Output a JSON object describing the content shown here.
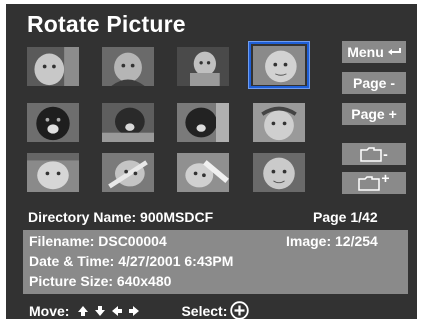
{
  "title": "Rotate Picture",
  "thumbnails": [
    {
      "row": 0,
      "col": 0,
      "selected": false
    },
    {
      "row": 0,
      "col": 1,
      "selected": false
    },
    {
      "row": 0,
      "col": 2,
      "selected": false
    },
    {
      "row": 0,
      "col": 3,
      "selected": true
    },
    {
      "row": 1,
      "col": 0,
      "selected": false
    },
    {
      "row": 1,
      "col": 1,
      "selected": false
    },
    {
      "row": 1,
      "col": 2,
      "selected": false
    },
    {
      "row": 1,
      "col": 3,
      "selected": false
    },
    {
      "row": 2,
      "col": 0,
      "selected": false
    },
    {
      "row": 2,
      "col": 1,
      "selected": false
    },
    {
      "row": 2,
      "col": 2,
      "selected": false
    },
    {
      "row": 2,
      "col": 3,
      "selected": false
    }
  ],
  "sidebar": {
    "menu_label": "Menu",
    "menu_icon": "return-arrow-icon",
    "page_prev_label": "Page -",
    "page_next_label": "Page +",
    "folder_prev_suffix": "-",
    "folder_next_suffix": "+"
  },
  "directory": {
    "name_label": "Directory Name: 900MSDCF",
    "page_label": "Page 1/42"
  },
  "details": {
    "filename": "Filename: DSC00004",
    "image": "Image: 12/254",
    "datetime": "Date & Time: 4/27/2001 6:43PM",
    "size": "Picture Size: 640x480"
  },
  "footer": {
    "move_label": "Move:",
    "select_label": "Select:",
    "arrows": [
      "up-arrow-icon",
      "down-arrow-icon",
      "left-arrow-icon",
      "right-arrow-icon"
    ]
  },
  "colors": {
    "background": "#323232",
    "panel": "#8a8a8a",
    "selection": "#1f5fd6",
    "text": "#ffffff"
  }
}
